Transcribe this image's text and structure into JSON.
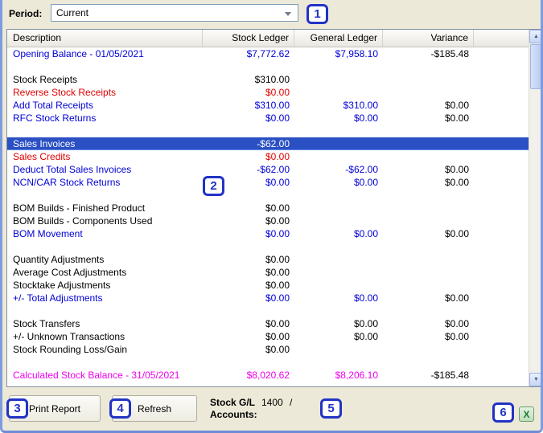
{
  "period": {
    "label": "Period:",
    "value": "Current"
  },
  "table": {
    "columns": [
      "Description",
      "Stock Ledger",
      "General Ledger",
      "Variance"
    ],
    "rows": [
      {
        "desc": "Opening Balance - 01/05/2021",
        "stock": "$7,772.62",
        "general": "$7,958.10",
        "variance": "-$185.48",
        "style": "blue"
      },
      {
        "desc": "",
        "stock": "",
        "general": "",
        "variance": "",
        "style": "spacer"
      },
      {
        "desc": "Stock Receipts",
        "stock": "$310.00",
        "general": "",
        "variance": "",
        "style": "black"
      },
      {
        "desc": "Reverse Stock Receipts",
        "stock": "$0.00",
        "general": "",
        "variance": "",
        "style": "red"
      },
      {
        "desc": "Add Total Receipts",
        "stock": "$310.00",
        "general": "$310.00",
        "variance": "$0.00",
        "style": "blue"
      },
      {
        "desc": "RFC Stock Returns",
        "stock": "$0.00",
        "general": "$0.00",
        "variance": "$0.00",
        "style": "blue"
      },
      {
        "desc": "",
        "stock": "",
        "general": "",
        "variance": "",
        "style": "spacer"
      },
      {
        "desc": "Sales Invoices",
        "stock": "-$62.00",
        "general": "",
        "variance": "",
        "style": "selected"
      },
      {
        "desc": "Sales Credits",
        "stock": "$0.00",
        "general": "",
        "variance": "",
        "style": "red"
      },
      {
        "desc": "Deduct Total Sales Invoices",
        "stock": "-$62.00",
        "general": "-$62.00",
        "variance": "$0.00",
        "style": "blue"
      },
      {
        "desc": "NCN/CAR Stock Returns",
        "stock": "$0.00",
        "general": "$0.00",
        "variance": "$0.00",
        "style": "blue"
      },
      {
        "desc": "",
        "stock": "",
        "general": "",
        "variance": "",
        "style": "spacer"
      },
      {
        "desc": "BOM Builds - Finished Product",
        "stock": "$0.00",
        "general": "",
        "variance": "",
        "style": "black"
      },
      {
        "desc": "BOM Builds - Components Used",
        "stock": "$0.00",
        "general": "",
        "variance": "",
        "style": "black"
      },
      {
        "desc": "BOM Movement",
        "stock": "$0.00",
        "general": "$0.00",
        "variance": "$0.00",
        "style": "blue"
      },
      {
        "desc": "",
        "stock": "",
        "general": "",
        "variance": "",
        "style": "spacer"
      },
      {
        "desc": "Quantity Adjustments",
        "stock": "$0.00",
        "general": "",
        "variance": "",
        "style": "black"
      },
      {
        "desc": "Average Cost Adjustments",
        "stock": "$0.00",
        "general": "",
        "variance": "",
        "style": "black"
      },
      {
        "desc": "Stocktake Adjustments",
        "stock": "$0.00",
        "general": "",
        "variance": "",
        "style": "black"
      },
      {
        "desc": "+/- Total Adjustments",
        "stock": "$0.00",
        "general": "$0.00",
        "variance": "$0.00",
        "style": "blue"
      },
      {
        "desc": "",
        "stock": "",
        "general": "",
        "variance": "",
        "style": "spacer"
      },
      {
        "desc": "Stock Transfers",
        "stock": "$0.00",
        "general": "$0.00",
        "variance": "$0.00",
        "style": "black"
      },
      {
        "desc": "+/- Unknown Transactions",
        "stock": "$0.00",
        "general": "$0.00",
        "variance": "$0.00",
        "style": "black"
      },
      {
        "desc": "Stock Rounding Loss/Gain",
        "stock": "$0.00",
        "general": "",
        "variance": "",
        "style": "black"
      },
      {
        "desc": "",
        "stock": "",
        "general": "",
        "variance": "",
        "style": "spacer"
      },
      {
        "desc": "Calculated Stock Balance - 31/05/2021",
        "stock": "$8,020.62",
        "general": "$8,206.10",
        "variance": "-$185.48",
        "style": "magenta"
      }
    ]
  },
  "footer": {
    "print_button": "Print Report",
    "refresh_button": "Refresh",
    "accounts_label_line1": "Stock G/L",
    "accounts_label_line2": "Accounts:",
    "accounts_value": "1400",
    "accounts_separator": "/"
  },
  "callouts": [
    "1",
    "2",
    "3",
    "4",
    "5",
    "6"
  ],
  "icons": {
    "excel_glyph": "X",
    "scroll_up_glyph": "▲",
    "scroll_down_glyph": "▼"
  },
  "colors": {
    "blue_text": "#0000D8",
    "red_text": "#E00000",
    "magenta_text": "#EE00EE",
    "selected_row_bg": "#2B50C3",
    "callout_blue": "#2233C4",
    "window_bg": "#ECE9D8"
  }
}
